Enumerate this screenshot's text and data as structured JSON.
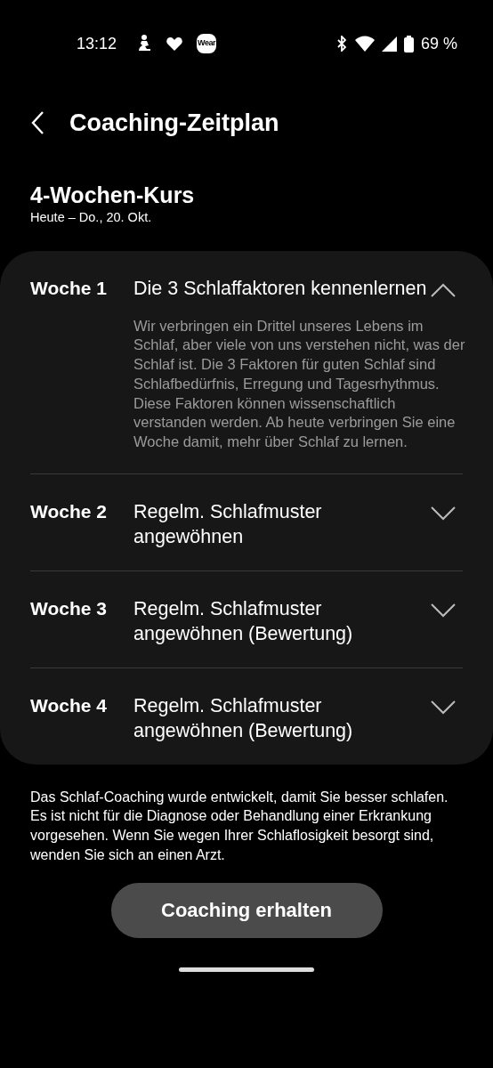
{
  "status_bar": {
    "time": "13:12",
    "app_badge": "Wear",
    "battery": "69 %"
  },
  "header": {
    "title": "Coaching-Zeitplan"
  },
  "course": {
    "title": "4-Wochen-Kurs",
    "dates": "Heute – Do., 20. Okt."
  },
  "weeks": [
    {
      "label": "Woche 1",
      "title": "Die 3 Schlaffaktoren kennenlernen",
      "expanded": true,
      "description": "Wir verbringen ein Drittel unseres Lebens im Schlaf, aber viele von uns verstehen nicht, was der Schlaf ist. Die 3 Faktoren für guten Schlaf sind Schlafbedürfnis, Erregung und Tagesrhythmus. Diese Faktoren können wissenschaftlich verstanden werden. Ab heute verbringen Sie eine Woche damit, mehr über Schlaf zu lernen."
    },
    {
      "label": "Woche 2",
      "title": "Regelm. Schlafmuster angewöhnen",
      "expanded": false
    },
    {
      "label": "Woche 3",
      "title": "Regelm. Schlafmuster angewöhnen (Bewertung)",
      "expanded": false
    },
    {
      "label": "Woche 4",
      "title": "Regelm. Schlafmuster angewöhnen (Bewertung)",
      "expanded": false
    }
  ],
  "disclaimer": "Das Schlaf-Coaching wurde entwickelt, damit Sie besser schlafen. Es ist nicht für die Diagnose oder Behandlung einer Erkrankung vorgesehen. Wenn Sie wegen Ihrer Schlaflosigkeit besorgt sind, wenden Sie sich an einen Arzt.",
  "button": "Coaching erhalten"
}
